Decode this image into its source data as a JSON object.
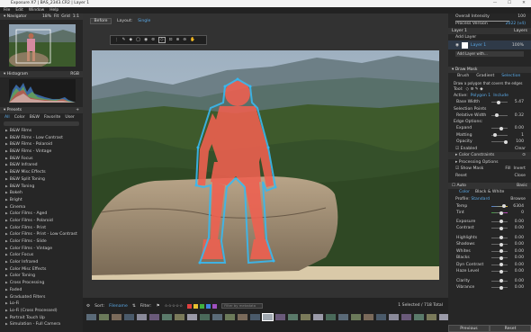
{
  "window": {
    "title": "Exposure X7 | BAS_2343.CR2 | Layer 1",
    "min": "—",
    "max": "☐",
    "close": "✕"
  },
  "menu": [
    "File",
    "Edit",
    "Window",
    "Help"
  ],
  "navigator": {
    "title": "Navigator",
    "zoom": "18%",
    "fit": "Fit",
    "grid": "Grid",
    "one_to_one": "1:1"
  },
  "histogram": {
    "title": "Histogram",
    "mode": "RGB"
  },
  "presets": {
    "title": "Presets",
    "tabs": [
      "All",
      "Color",
      "B&W",
      "Favorite",
      "User"
    ],
    "items": [
      "B&W Films",
      "B&W Films - Low Contrast",
      "B&W Films - Polaroid",
      "B&W Films - Vintage",
      "B&W Focus",
      "B&W Infrared",
      "B&W Misc Effects",
      "B&W Split Toning",
      "B&W Toning",
      "Bokeh",
      "Bright",
      "Cinema",
      "Color Films - Aged",
      "Color Films - Polaroid",
      "Color Films - Print",
      "Color Films - Print - Low Contrast",
      "Color Films - Slide",
      "Color Films - Vintage",
      "Color Focus",
      "Color Infrared",
      "Color Misc Effects",
      "Color Toning",
      "Cross Processing",
      "Faded",
      "Graduated Filters",
      "Lo-Fi",
      "Lo-Fi (Cross Processed)",
      "Portrait Touch Up",
      "Simulation - Full Camera"
    ]
  },
  "center": {
    "before": "Before",
    "layout_label": "Layout:",
    "layout_value": "Single"
  },
  "filmstrip_bar": {
    "sort_label": "Sort:",
    "sort_value": "Filename",
    "filter_label": "Filter:",
    "filter_placeholder": "Filter by metadata",
    "selection": "1 Selected / 718 Total"
  },
  "right": {
    "overall_intensity": "Overall Intensity",
    "overall_value": "100",
    "process_version": "Process Version",
    "process_value": "2022 (v4)",
    "layer_title": "Layer 1",
    "layers_label": "Layers",
    "add_layer": "Add Layer",
    "layer_name": "Layer 1",
    "layer_opacity": "100%",
    "add_layer_with": "Add Layer with...",
    "draw_mask": "Draw Mask",
    "mask_tabs": [
      "Brush",
      "Gradient",
      "Selection"
    ],
    "mask_hint": "Draw a polygon that covers the edges",
    "tool_label": "Tool:",
    "active_label": "Active:",
    "active_value": "Polygon 1",
    "include_value": "Include",
    "base_width": "Base Width",
    "base_width_value": "5.47",
    "selection_points": "Selection Points",
    "relative_width": "Relative Width",
    "relative_width_value": "0.32",
    "edge_options": "Edge Options:",
    "expand": "Expand",
    "expand_value": "0.00",
    "matting": "Matting",
    "matting_value": "1",
    "opacity": "Opacity",
    "opacity_value": "100",
    "enabled": "Enabled",
    "clear": "Clear",
    "color_constraints": "Color Constraints",
    "processing_options": "Processing Options",
    "show_mask": "Show Mask",
    "fill": "Fill",
    "invert": "Invert",
    "reset": "Reset",
    "close": "Close",
    "auto": "Auto",
    "basic": "Basic",
    "color": "Color",
    "bw": "Black & White",
    "profile_label": "Profile:",
    "profile_value": "Standard",
    "browse": "Browse",
    "temp": "Temp",
    "temp_value": "6304",
    "tint": "Tint",
    "tint_value": "0",
    "sliders": [
      {
        "label": "Exposure",
        "value": "0.00"
      },
      {
        "label": "Contrast",
        "value": "0.00"
      },
      {
        "label": "Highlights",
        "value": "0.00"
      },
      {
        "label": "Shadows",
        "value": "0.00"
      },
      {
        "label": "Whites",
        "value": "0.00"
      },
      {
        "label": "Blacks",
        "value": "0.00"
      },
      {
        "label": "Dyn Contrast",
        "value": "0.00"
      },
      {
        "label": "Haze Level",
        "value": "0.00"
      },
      {
        "label": "Clarity",
        "value": "0.00"
      },
      {
        "label": "Vibrance",
        "value": "0.00"
      }
    ],
    "previous": "Previous",
    "reset_all": "Reset"
  },
  "colors": {
    "accent": "#3aa0e0",
    "bg": "#2b2b2b",
    "panel": "#262626",
    "mask": "#ff4d2e"
  }
}
